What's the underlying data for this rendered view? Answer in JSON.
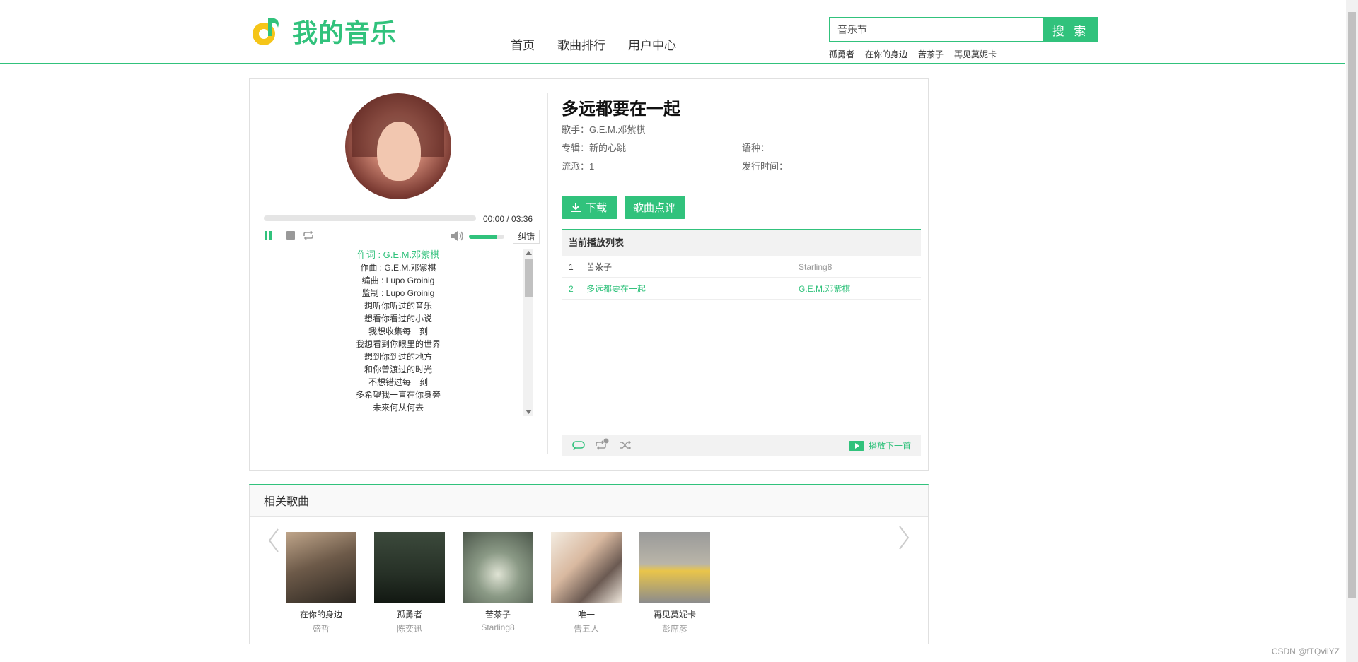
{
  "brand": {
    "name": "我的音乐",
    "accent": "#31c27c"
  },
  "nav": [
    "首页",
    "歌曲排行",
    "用户中心"
  ],
  "search": {
    "value": "音乐节",
    "button": "搜 索",
    "hot": [
      "孤勇者",
      "在你的身边",
      "苦茶子",
      "再见莫妮卡"
    ]
  },
  "player": {
    "time": "00:00 / 03:36",
    "progress": 0,
    "volume": 0.8,
    "correct_label": "纠错",
    "lyrics": [
      "作词 : G.E.M.邓紫棋",
      "作曲 : G.E.M.邓紫棋",
      "编曲 : Lupo Groinig",
      "监制 : Lupo Groinig",
      "想听你听过的音乐",
      "想看你看过的小说",
      "我想收集每一刻",
      "我想看到你眼里的世界",
      "想到你到过的地方",
      "和你曾渡过的时光",
      "不想错过每一刻",
      "多希望我一直在你身旁",
      "未来何从何去"
    ]
  },
  "song": {
    "title": "多远都要在一起",
    "singer": "歌手：G.E.M.邓紫棋",
    "album": "专辑：新的心跳",
    "language": "语种：",
    "genre": "流派：1",
    "release": "发行时间：",
    "download_label": "下载",
    "comment_label": "歌曲点评"
  },
  "playlist": {
    "title": "当前播放列表",
    "rows": [
      {
        "no": "1",
        "name": "苦茶子",
        "artist": "Starling8"
      },
      {
        "no": "2",
        "name": "多远都要在一起",
        "artist": "G.E.M.邓紫棋"
      }
    ],
    "next_label": "播放下一首"
  },
  "related": {
    "title": "相关歌曲",
    "items": [
      {
        "name": "在你的身边",
        "artist": "盛哲"
      },
      {
        "name": "孤勇者",
        "artist": "陈奕迅"
      },
      {
        "name": "苦茶子",
        "artist": "Starling8"
      },
      {
        "name": "唯一",
        "artist": "告五人"
      },
      {
        "name": "再见莫妮卡",
        "artist": "彭席彦"
      }
    ]
  },
  "watermark": "CSDN @fTQvilYZ"
}
